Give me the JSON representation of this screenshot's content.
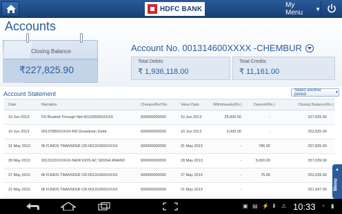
{
  "topbar": {
    "logo_text": "HDFC BANK",
    "menu_label": "My Menu"
  },
  "header": {
    "page_title": "Accounts",
    "closing_balance_label": "Closing Balance",
    "closing_balance_value": "₹227,825.90",
    "account_label": "Account No. 001314600XXXX -CHEMBUR",
    "total_debits_label": "Total Debits",
    "total_debits_value": "₹ 1,936,118.00",
    "total_credits_label": "Total Credits",
    "total_credits_value": "₹ 11,161.00"
  },
  "statement": {
    "title": "Account Statement",
    "period_button": "Select another period",
    "columns": [
      "Date",
      "Narration",
      "Cheque/Ref No.",
      "Value Date",
      "Withdrawals(Rs.)",
      "Deposit(Rs.)",
      "Closing Balance(Rs.)"
    ],
    "rows": [
      {
        "date": "10 Jun 2013",
        "narration": "FD Booked Through Net-00133500XXXXX",
        "cheque": "000000000000",
        "value_date": "10 Jun 2013",
        "withdrawal": "25,000.00",
        "deposit": "-",
        "balance": "227,825.90"
      },
      {
        "date": "10 Jun 2013",
        "narration": "00137850XXXXX-RD Drawdown Debit",
        "cheque": "000000000000",
        "value_date": "10 Jun 2013",
        "withdrawal": "5,000.00",
        "deposit": "-",
        "balance": "252,825.90"
      },
      {
        "date": "31 May 2013",
        "narration": "IB FUNDS TRANSFER CR-00131000XXXXX",
        "cheque": "000000000000",
        "value_date": "31 May 2013",
        "withdrawal": "-",
        "deposit": "786.00",
        "balance": "257,825.90"
      },
      {
        "date": "28 May 2013",
        "narration": "00131020XXXXX-NEW KIDS AC SIDDHI ANAND",
        "cheque": "000000000000",
        "value_date": "28 May 2013",
        "withdrawal": "-",
        "deposit": "5,000.00",
        "balance": "257,039.90"
      },
      {
        "date": "27 May 2013",
        "narration": "IB FUNDS TRANSFER CR-00131000XXXXX",
        "cheque": "000000000000",
        "value_date": "27 May 2013",
        "withdrawal": "-",
        "deposit": "75.00",
        "balance": "252,039.90"
      },
      {
        "date": "21 May 2013",
        "narration": "IB FUNDS TRANSFER CR-00131000XXXXX",
        "cheque": "000000000000",
        "value_date": "21 May 2013",
        "withdrawal": "-",
        "deposit": "",
        "balance": "251,997.90"
      }
    ]
  },
  "side_tab_label": "Menu",
  "android": {
    "time": "10:33"
  }
}
